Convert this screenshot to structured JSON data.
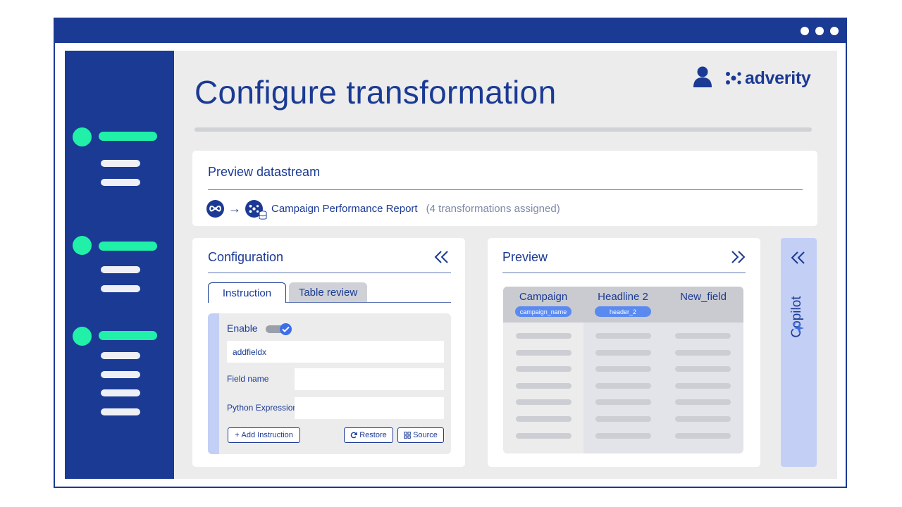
{
  "header": {
    "title": "Configure transformation",
    "brand": "adverity"
  },
  "colors": {
    "primary": "#1b3a94",
    "accent_green": "#20f0a8",
    "accent_blue": "#3b6ee8",
    "panel_bg": "#ececec",
    "copilot_bg": "#c3cff5"
  },
  "preview_datastream": {
    "title": "Preview datastream",
    "source_icon": "meta-icon",
    "target_icon": "adverity-datastream-icon",
    "report_name": "Campaign Performance Report",
    "assigned": "(4 transformations assigned)"
  },
  "configuration": {
    "title": "Configuration",
    "tabs": [
      {
        "label": "Instruction",
        "active": true
      },
      {
        "label": "Table review",
        "active": false
      }
    ],
    "instruction": {
      "enable_label": "Enable",
      "enabled": true,
      "instruction_value": "addfieldx",
      "field_name_label": "Field name",
      "field_name_value": "",
      "python_expression_label": "Python Expression",
      "python_expression_value": "",
      "add_instruction_label": "Add Instruction",
      "restore_label": "Restore",
      "source_label": "Source"
    }
  },
  "preview": {
    "title": "Preview",
    "columns": [
      {
        "header": "Campaign",
        "badge": "campaign_name"
      },
      {
        "header": "Headline 2",
        "badge": "header_2"
      },
      {
        "header": "New_field",
        "badge": ""
      }
    ]
  },
  "copilot": {
    "label": "Copilot"
  }
}
